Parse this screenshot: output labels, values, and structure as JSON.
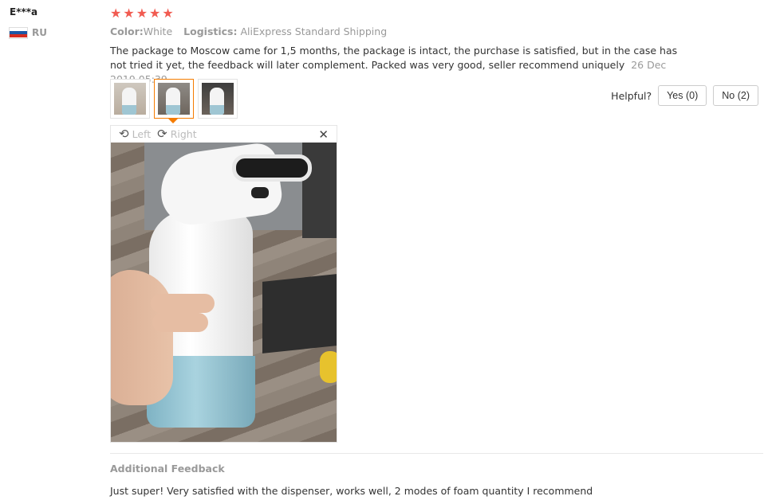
{
  "reviewer": {
    "name": "E***a",
    "country_code": "RU",
    "flag_colors": [
      "#ffffff",
      "#1c57a5",
      "#d52b1e"
    ]
  },
  "rating": {
    "stars": 5,
    "max": 5,
    "color": "#f15b51"
  },
  "meta": {
    "color_label": "Color:",
    "color_value": "White",
    "logistics_label": "Logistics:",
    "logistics_value": "AliExpress Standard Shipping"
  },
  "review": {
    "text": "The package to Moscow came for 1,5 months, the package is intact, the purchase is satisfied, but in the case has not tried it yet, the feedback will later complement. Packed was very good, seller recommend uniquely",
    "date": "26 Dec 2019 05:39"
  },
  "thumbnails": [
    {
      "name": "photo-1",
      "active": false
    },
    {
      "name": "photo-2",
      "active": true
    },
    {
      "name": "photo-3",
      "active": false
    }
  ],
  "helpful": {
    "label": "Helpful?",
    "yes_label": "Yes (0)",
    "no_label": "No (2)"
  },
  "viewer": {
    "rotate_left_label": "Left",
    "rotate_right_label": "Right",
    "rotate_left_icon": "rotate-left-icon",
    "rotate_right_icon": "rotate-right-icon",
    "close_icon": "close-icon"
  },
  "additional_feedback": {
    "title": "Additional Feedback",
    "text": "Just super! Very satisfied with the dispenser, works well, 2 modes of foam quantity I recommend"
  },
  "accent_color": "#f57c00"
}
